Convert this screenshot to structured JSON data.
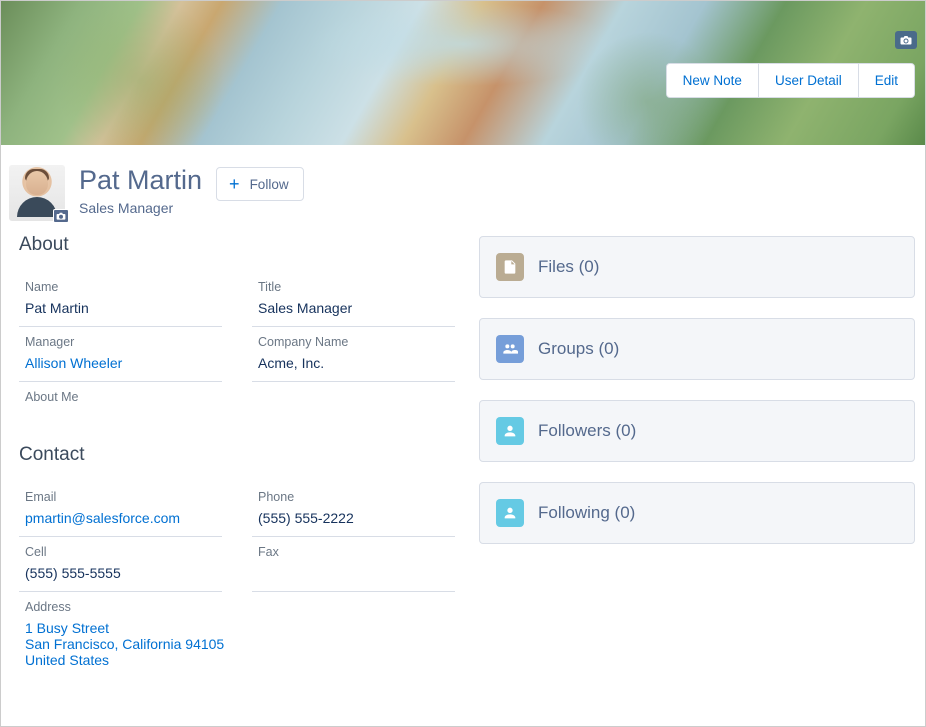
{
  "header": {
    "actions": {
      "new_note": "New Note",
      "user_detail": "User Detail",
      "edit": "Edit"
    }
  },
  "profile": {
    "name": "Pat Martin",
    "role": "Sales Manager",
    "follow_label": "Follow"
  },
  "about": {
    "title": "About",
    "name_label": "Name",
    "name_value": "Pat Martin",
    "title_label": "Title",
    "title_value": "Sales Manager",
    "manager_label": "Manager",
    "manager_value": "Allison Wheeler",
    "company_label": "Company Name",
    "company_value": "Acme, Inc.",
    "aboutme_label": "About Me"
  },
  "contact": {
    "title": "Contact",
    "email_label": "Email",
    "email_value": "pmartin@salesforce.com",
    "phone_label": "Phone",
    "phone_value": "(555) 555-2222",
    "cell_label": "Cell",
    "cell_value": "(555) 555-5555",
    "fax_label": "Fax",
    "fax_value": "",
    "address_label": "Address",
    "address_line1": "1 Busy Street",
    "address_line2": "San Francisco, California 94105",
    "address_line3": "United States"
  },
  "sidebar": {
    "files": "Files (0)",
    "groups": "Groups (0)",
    "followers": "Followers (0)",
    "following": "Following (0)"
  }
}
